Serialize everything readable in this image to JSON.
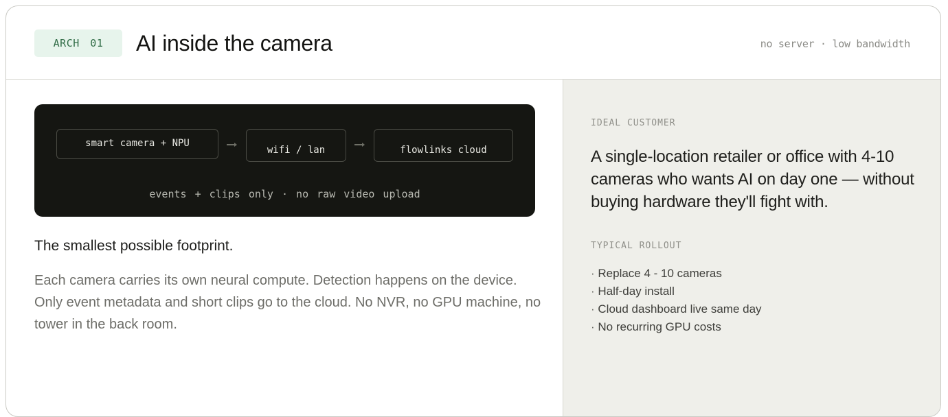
{
  "header": {
    "badge": "ARCH 01",
    "title": "AI inside the camera",
    "tag": "no server · low bandwidth"
  },
  "diagram": {
    "nodes": [
      "smart camera + NPU",
      "wifi / lan",
      "flowlinks cloud"
    ],
    "caption": "events + clips only · no raw video upload"
  },
  "main": {
    "headline": "The smallest possible footprint.",
    "body": "Each camera carries its own neural compute. Detection happens on the device. Only event metadata and short clips go to the cloud. No NVR, no GPU machine, no tower in the back room."
  },
  "sidebar": {
    "customer_label": "IDEAL CUSTOMER",
    "customer_text": "A single-location retailer or office with 4-10 cameras who wants AI on day one — without buying hardware they'll fight with.",
    "rollout_label": "TYPICAL ROLLOUT",
    "rollout_items": [
      "Replace 4 - 10 cameras",
      "Half-day install",
      "Cloud dashboard live same day",
      "No recurring GPU costs"
    ]
  },
  "colors": {
    "badge_bg": "#e7f4ec",
    "badge_text": "#2f6b45",
    "diagram_bg": "#151612",
    "sidebar_bg": "#efefea"
  }
}
